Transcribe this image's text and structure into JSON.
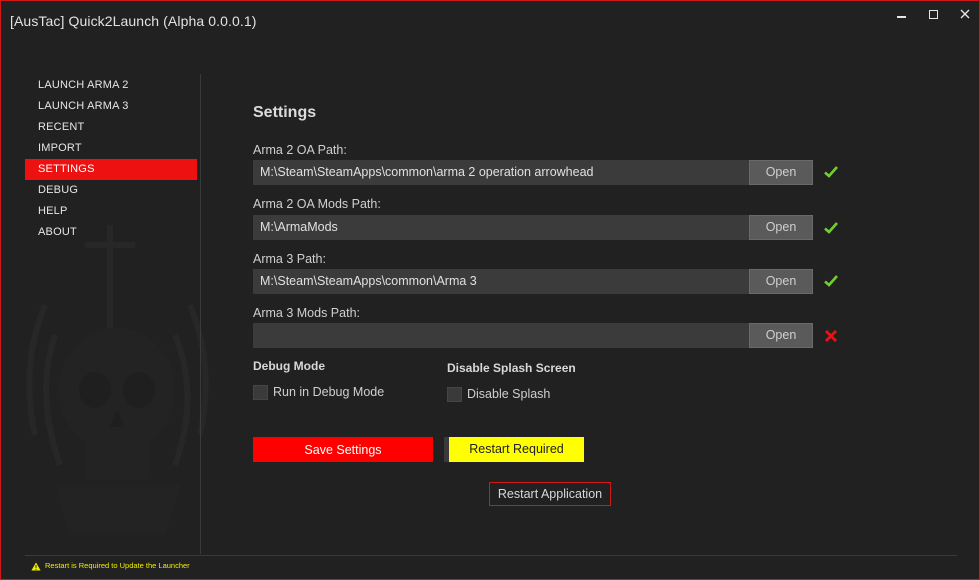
{
  "window": {
    "title": "[AusTac] Quick2Launch (Alpha 0.0.0.1)",
    "accent": "#d01818"
  },
  "sidebar": {
    "items": [
      {
        "label": "LAUNCH ARMA 2",
        "active": false
      },
      {
        "label": "LAUNCH ARMA 3",
        "active": false
      },
      {
        "label": "RECENT",
        "active": false
      },
      {
        "label": "IMPORT",
        "active": false
      },
      {
        "label": "SETTINGS",
        "active": true
      },
      {
        "label": "DEBUG",
        "active": false
      },
      {
        "label": "HELP",
        "active": false
      },
      {
        "label": "ABOUT",
        "active": false
      }
    ]
  },
  "settings": {
    "title": "Settings",
    "fields": [
      {
        "label": "Arma 2 OA Path:",
        "value": "M:\\Steam\\SteamApps\\common\\arma 2 operation arrowhead",
        "button": "Open",
        "status": "ok"
      },
      {
        "label": "Arma 2 OA Mods Path:",
        "value": "M:\\ArmaMods",
        "button": "Open",
        "status": "ok"
      },
      {
        "label": "Arma 3 Path:",
        "value": "M:\\Steam\\SteamApps\\common\\Arma 3",
        "button": "Open",
        "status": "ok"
      },
      {
        "label": "Arma 3 Mods Path:",
        "value": "",
        "button": "Open",
        "status": "error"
      }
    ],
    "debug": {
      "heading": "Debug Mode",
      "checkbox_label": "Run in Debug Mode",
      "checked": false
    },
    "splash": {
      "heading": "Disable Splash Screen",
      "checkbox_label": "Disable Splash",
      "checked": false
    },
    "save_label": "Save Settings",
    "restart_required_label": "Restart Required",
    "restart_app_label": "Restart Application"
  },
  "status_bar": {
    "icon": "warning-icon",
    "message": "Restart is Required to Update the Launcher"
  },
  "colors": {
    "ok": "#6fd12a",
    "error": "#ee1111",
    "save": "#ff0000",
    "restart_required": "#ffff00",
    "status_text": "#f0f000"
  }
}
